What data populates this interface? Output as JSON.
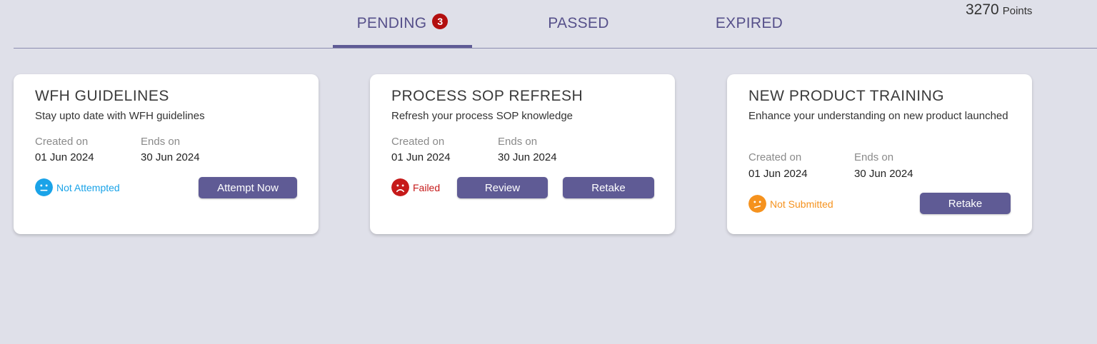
{
  "tabs": [
    {
      "label": "PENDING",
      "badge": "3"
    },
    {
      "label": "PASSED"
    },
    {
      "label": "EXPIRED"
    }
  ],
  "points": {
    "value": "3270",
    "label": "Points"
  },
  "labels": {
    "created": "Created on",
    "ends": "Ends on"
  },
  "colors": {
    "accent": "#5f5b95",
    "not_attempted": "#1aa3e8",
    "failed": "#c61a1a",
    "not_submitted": "#f5921e"
  },
  "cards": [
    {
      "title": "WFH GUIDELINES",
      "description": "Stay upto date with WFH guidelines",
      "created": "01 Jun 2024",
      "ends": "30 Jun 2024",
      "status": "Not Attempted",
      "status_icon": "neutral-face-icon",
      "buttons": [
        "Attempt Now"
      ]
    },
    {
      "title": "PROCESS SOP REFRESH",
      "description": "Refresh your process SOP knowledge",
      "created": "01 Jun 2024",
      "ends": "30 Jun 2024",
      "status": "Failed",
      "status_icon": "sad-face-icon",
      "buttons": [
        "Review",
        "Retake"
      ]
    },
    {
      "title": "NEW PRODUCT TRAINING",
      "description": "Enhance your understanding on new product launched",
      "created": "01 Jun 2024",
      "ends": "30 Jun 2024",
      "status": "Not Submitted",
      "status_icon": "confused-face-icon",
      "buttons": [
        "Retake"
      ]
    }
  ]
}
